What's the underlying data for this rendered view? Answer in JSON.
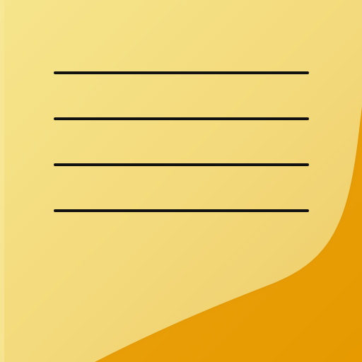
{
  "icon": {
    "name": "sticky-note-icon",
    "colors": {
      "note_light": "#F6E58C",
      "note_mid": "#F3D97A",
      "note_dark": "#EDCB68",
      "fold_light": "#ECA515",
      "fold_dark": "#E69A00",
      "line": "#111111"
    },
    "text_line_count": 4
  }
}
